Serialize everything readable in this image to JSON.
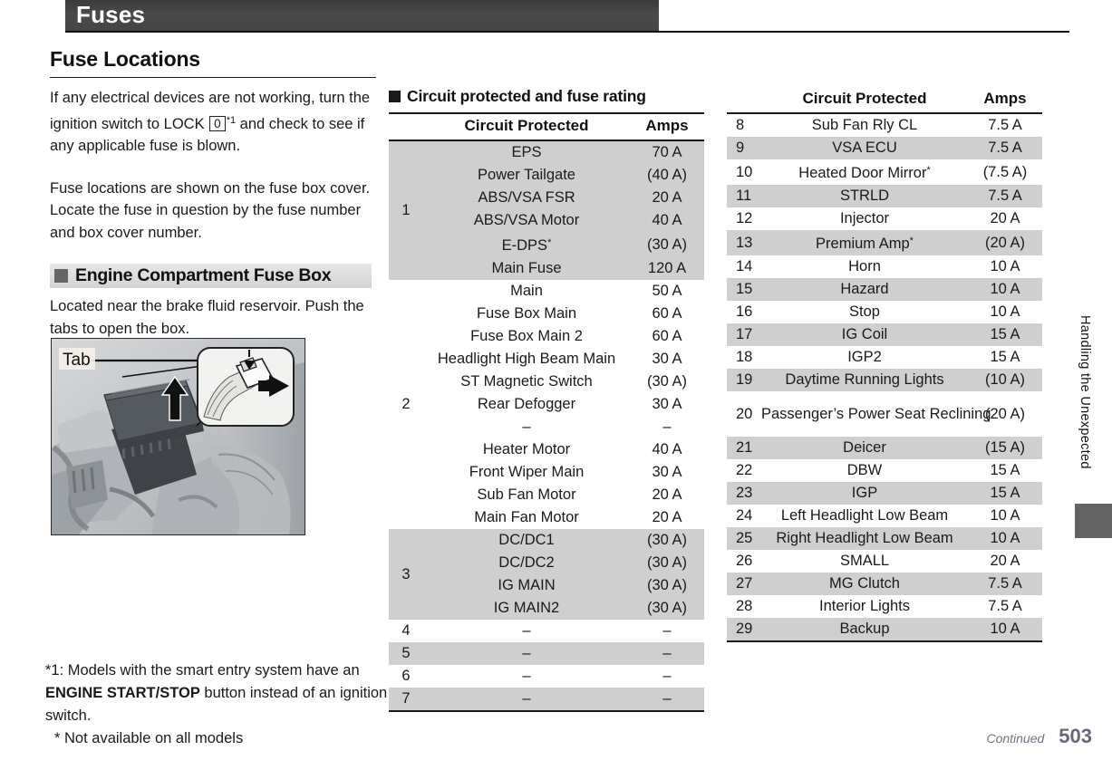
{
  "header": {
    "title": "Fuses"
  },
  "left": {
    "section_title": "Fuse Locations",
    "para1_a": "If any electrical devices are not working, turn the ignition switch to LOCK ",
    "lock_symbol": "0",
    "para1_sup": "*1",
    "para1_b": " and check to see if any applicable fuse is blown.",
    "para2": "Fuse locations are shown on the fuse box cover. Locate the fuse in question by the fuse number and box cover number.",
    "subheading": "Engine Compartment Fuse Box",
    "para3": "Located near the brake fluid reservoir. Push the tabs to open the box.",
    "illustration_label": "Tab"
  },
  "footnotes": {
    "note1_a": "*1: Models with the smart entry system have an ",
    "note1_bold": "ENGINE START/STOP",
    "note1_b": " button instead of an ignition switch.",
    "note2": "* Not available on all models"
  },
  "middle": {
    "heading": "Circuit protected and fuse rating",
    "columns": {
      "number": "",
      "circuit": "Circuit Protected",
      "amps": "Amps"
    },
    "groups": [
      {
        "number": "1",
        "shaded": true,
        "rows": [
          {
            "circuit": "EPS",
            "amps": "70 A"
          },
          {
            "circuit": "Power Tailgate",
            "amps": "(40 A)"
          },
          {
            "circuit": "ABS/VSA FSR",
            "amps": "20 A"
          },
          {
            "circuit": "ABS/VSA Motor",
            "amps": "40 A"
          },
          {
            "circuit": "E-DPS",
            "star": "*",
            "amps": "(30 A)"
          },
          {
            "circuit": "Main Fuse",
            "amps": "120 A"
          }
        ]
      },
      {
        "number": "2",
        "shaded": false,
        "rows": [
          {
            "circuit": "Main",
            "amps": "50 A"
          },
          {
            "circuit": "Fuse Box Main",
            "amps": "60 A"
          },
          {
            "circuit": "Fuse Box Main 2",
            "amps": "60 A"
          },
          {
            "circuit": "Headlight High Beam Main",
            "amps": "30 A"
          },
          {
            "circuit": "ST Magnetic Switch",
            "amps": "(30 A)"
          },
          {
            "circuit": "Rear Defogger",
            "amps": "30 A"
          },
          {
            "circuit": "–",
            "amps": "–"
          },
          {
            "circuit": "Heater Motor",
            "amps": "40 A"
          },
          {
            "circuit": "Front Wiper Main",
            "amps": "30 A"
          },
          {
            "circuit": "Sub Fan Motor",
            "amps": "20 A"
          },
          {
            "circuit": "Main Fan Motor",
            "amps": "20 A"
          }
        ]
      },
      {
        "number": "3",
        "shaded": true,
        "rows": [
          {
            "circuit": "DC/DC1",
            "amps": "(30 A)"
          },
          {
            "circuit": "DC/DC2",
            "amps": "(30 A)"
          },
          {
            "circuit": "IG MAIN",
            "amps": "(30 A)"
          },
          {
            "circuit": "IG MAIN2",
            "amps": "(30 A)"
          }
        ]
      },
      {
        "number": "4",
        "shaded": false,
        "rows": [
          {
            "circuit": "–",
            "amps": "–"
          }
        ]
      },
      {
        "number": "5",
        "shaded": true,
        "rows": [
          {
            "circuit": "–",
            "amps": "–"
          }
        ]
      },
      {
        "number": "6",
        "shaded": false,
        "rows": [
          {
            "circuit": "–",
            "amps": "–"
          }
        ]
      },
      {
        "number": "7",
        "shaded": true,
        "rows": [
          {
            "circuit": "–",
            "amps": "–"
          }
        ]
      }
    ]
  },
  "right": {
    "columns": {
      "number": "",
      "circuit": "Circuit Protected",
      "amps": "Amps"
    },
    "rows": [
      {
        "number": "8",
        "circuit": "Sub Fan Rly CL",
        "amps": "7.5 A",
        "shaded": false
      },
      {
        "number": "9",
        "circuit": "VSA ECU",
        "amps": "7.5 A",
        "shaded": true
      },
      {
        "number": "10",
        "circuit": "Heated Door Mirror",
        "star": "*",
        "amps": "(7.5 A)",
        "shaded": false
      },
      {
        "number": "11",
        "circuit": "STRLD",
        "amps": "7.5 A",
        "shaded": true
      },
      {
        "number": "12",
        "circuit": "Injector",
        "amps": "20 A",
        "shaded": false
      },
      {
        "number": "13",
        "circuit": "Premium Amp",
        "star": "*",
        "amps": "(20 A)",
        "shaded": true
      },
      {
        "number": "14",
        "circuit": "Horn",
        "amps": "10 A",
        "shaded": false
      },
      {
        "number": "15",
        "circuit": "Hazard",
        "amps": "10 A",
        "shaded": true
      },
      {
        "number": "16",
        "circuit": "Stop",
        "amps": "10 A",
        "shaded": false
      },
      {
        "number": "17",
        "circuit": "IG Coil",
        "amps": "15 A",
        "shaded": true
      },
      {
        "number": "18",
        "circuit": "IGP2",
        "amps": "15 A",
        "shaded": false
      },
      {
        "number": "19",
        "circuit": "Daytime Running Lights",
        "amps": "(10 A)",
        "shaded": true
      },
      {
        "number": "20",
        "circuit": "Passenger’s Power Seat Reclining",
        "amps": "(20 A)",
        "shaded": false,
        "tall": true
      },
      {
        "number": "21",
        "circuit": "Deicer",
        "amps": "(15 A)",
        "shaded": true
      },
      {
        "number": "22",
        "circuit": "DBW",
        "amps": "15 A",
        "shaded": false
      },
      {
        "number": "23",
        "circuit": "IGP",
        "amps": "15 A",
        "shaded": true
      },
      {
        "number": "24",
        "circuit": "Left Headlight Low Beam",
        "amps": "10 A",
        "shaded": false
      },
      {
        "number": "25",
        "circuit": "Right Headlight Low Beam",
        "amps": "10 A",
        "shaded": true
      },
      {
        "number": "26",
        "circuit": "SMALL",
        "amps": "20 A",
        "shaded": false
      },
      {
        "number": "27",
        "circuit": "MG Clutch",
        "amps": "7.5 A",
        "shaded": true
      },
      {
        "number": "28",
        "circuit": "Interior Lights",
        "amps": "7.5 A",
        "shaded": false
      },
      {
        "number": "29",
        "circuit": "Backup",
        "amps": "10 A",
        "shaded": true
      }
    ]
  },
  "thumb_index": {
    "label": "Handling the Unexpected"
  },
  "page_footer": {
    "continued": "Continued",
    "page_number": "503"
  }
}
